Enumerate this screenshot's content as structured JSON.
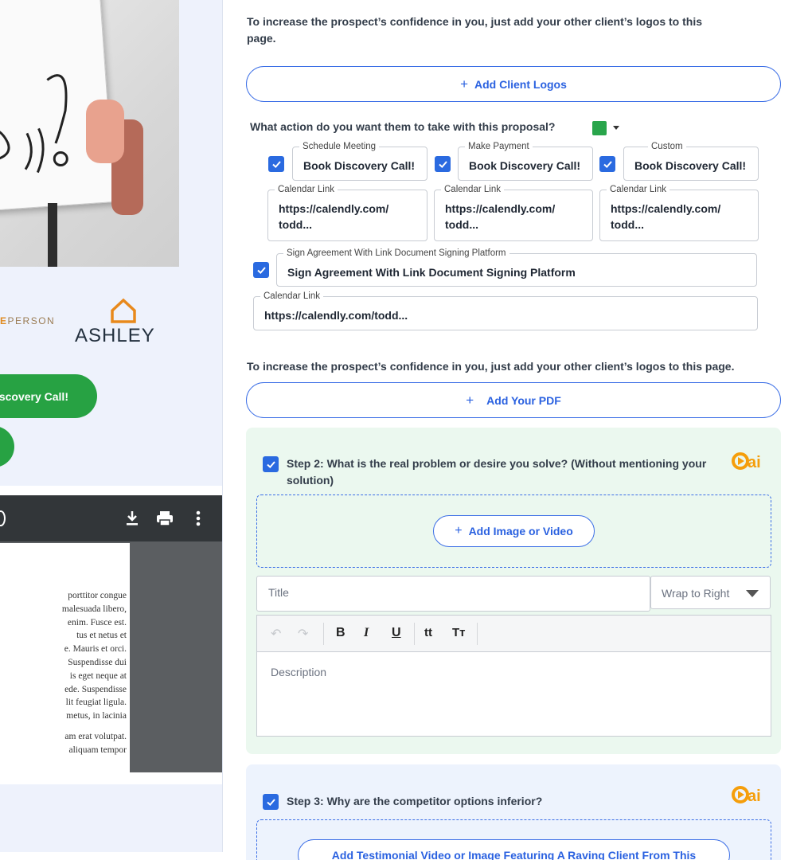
{
  "preview": {
    "partner_logo_accent": "E",
    "partner_logo_text": "PERSON",
    "brand_logo": "ASHLEY",
    "cta_label": "scovery Call!",
    "pdf_lines_1": [
      "porttitor congue",
      "malesuada libero,",
      "enim. Fusce est.",
      "tus et netus et",
      "e. Mauris et orci.",
      "Suspendisse dui",
      "is eget neque at",
      "ede. Suspendisse",
      "lit feugiat ligula.",
      "metus, in lacinia"
    ],
    "pdf_lines_2": [
      "am erat volutpat.",
      "aliquam tempor"
    ]
  },
  "editor": {
    "logos_instruction": "To increase the prospect’s confidence in you, just add your other client’s logos to this page.",
    "add_client_logos": "Add Client Logos",
    "action_question": "What action do you want them to take with this proposal?",
    "accent_color": "#29a54b",
    "actions": [
      {
        "label": "Schedule Meeting",
        "value": "Book Discovery Call!",
        "link_label": "Calendar Link",
        "link_value_1": "https://calendly.com/",
        "link_value_2": "todd..."
      },
      {
        "label": "Make Payment",
        "value": "Book Discovery Call!",
        "link_label": "Calendar Link",
        "link_value_1": "https://calendly.com/",
        "link_value_2": "todd..."
      },
      {
        "label": "Custom",
        "value": "Book Discovery Call!",
        "link_label": "Calendar Link",
        "link_value_1": "https://calendly.com/",
        "link_value_2": "todd..."
      }
    ],
    "sign": {
      "label": "Sign Agreement With Link Document Signing Platform",
      "value": "Sign Agreement With Link Document Signing Platform",
      "link_label": "Calendar Link",
      "link_value": "https://calendly.com/todd..."
    },
    "pdf_instruction": "To increase the prospect’s confidence in you, just add your other client’s logos to this page.",
    "add_pdf": "Add Your PDF",
    "step2": {
      "title": "Step 2: What is the real problem or desire you solve? (Without mentioning your solution)",
      "add_media": "Add Image or Video",
      "title_placeholder": "Title",
      "wrap_option": "Wrap to Right",
      "description_placeholder": "Description"
    },
    "step3": {
      "title": "Step 3: Why are the competitor options inferior?",
      "add_testimonial": "Add Testimonial Video or Image Featuring A Raving Client From This"
    }
  }
}
